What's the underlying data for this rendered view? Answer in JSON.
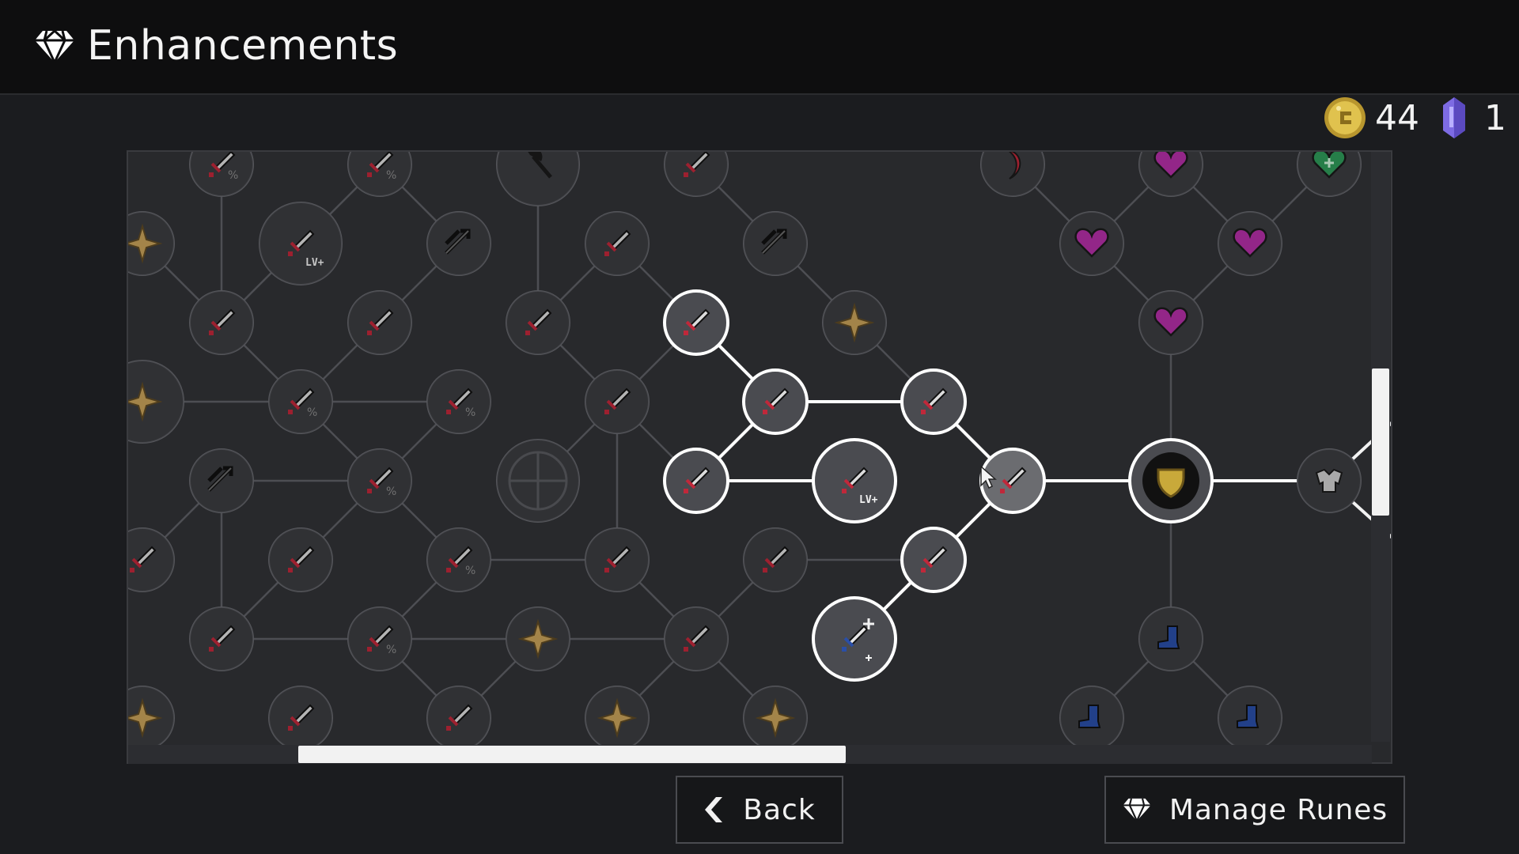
{
  "app": {
    "title": "Enhancements"
  },
  "currency": {
    "coins": {
      "icon": "gold-coin-icon",
      "value": "44"
    },
    "crystals": {
      "icon": "purple-crystal-icon",
      "value": "1"
    }
  },
  "buttons": {
    "back": {
      "label": "Back",
      "icon": "back-arrow-icon"
    },
    "manage_runes": {
      "label": "Manage Runes",
      "icon": "diamond-icon"
    }
  },
  "node_labels": {
    "level_up": "LV+"
  },
  "colors": {
    "background": "#1b1c1f",
    "panel": "#28292c",
    "node_locked": "#3b3c40",
    "node_unlocked": "#4a4b50",
    "highlight": "#ffffff",
    "heart": "#b42fa6",
    "shield_gold": "#c9a93a",
    "boot_blue": "#2a4fa8",
    "star_gold": "#c7a159"
  },
  "tree": {
    "nodes": [
      {
        "id": "n1",
        "kind": "sword-crit",
        "state": "locked"
      },
      {
        "id": "n2",
        "kind": "sword-crit",
        "state": "locked"
      },
      {
        "id": "n3",
        "kind": "axe",
        "state": "locked"
      },
      {
        "id": "n4",
        "kind": "sword",
        "state": "locked"
      },
      {
        "id": "n5",
        "kind": "moon",
        "state": "locked"
      },
      {
        "id": "n6",
        "kind": "heart",
        "state": "locked"
      },
      {
        "id": "n7",
        "kind": "green-heart",
        "state": "locked"
      },
      {
        "id": "n8",
        "kind": "star",
        "state": "locked"
      },
      {
        "id": "n9",
        "kind": "sword-level",
        "state": "locked"
      },
      {
        "id": "n10",
        "kind": "arrows",
        "state": "locked"
      },
      {
        "id": "n11",
        "kind": "sword",
        "state": "locked"
      },
      {
        "id": "n12",
        "kind": "arrows",
        "state": "locked"
      },
      {
        "id": "n13",
        "kind": "heart",
        "state": "locked"
      },
      {
        "id": "n14",
        "kind": "heart",
        "state": "locked"
      },
      {
        "id": "n15",
        "kind": "sword",
        "state": "locked"
      },
      {
        "id": "n16",
        "kind": "sword",
        "state": "locked"
      },
      {
        "id": "n17",
        "kind": "sword",
        "state": "locked"
      },
      {
        "id": "n18",
        "kind": "sword",
        "state": "unlocked"
      },
      {
        "id": "n19",
        "kind": "star",
        "state": "locked"
      },
      {
        "id": "n20",
        "kind": "heart",
        "state": "locked"
      },
      {
        "id": "n21",
        "kind": "star",
        "state": "locked"
      },
      {
        "id": "n22",
        "kind": "sword-crit",
        "state": "locked"
      },
      {
        "id": "n23",
        "kind": "sword-crit",
        "state": "locked"
      },
      {
        "id": "n24",
        "kind": "sword",
        "state": "locked"
      },
      {
        "id": "n25",
        "kind": "sword",
        "state": "unlocked"
      },
      {
        "id": "n26",
        "kind": "sword",
        "state": "unlocked"
      },
      {
        "id": "n27",
        "kind": "arrows",
        "state": "locked"
      },
      {
        "id": "n28",
        "kind": "sword-crit",
        "state": "locked"
      },
      {
        "id": "n29",
        "kind": "crosshair",
        "state": "locked"
      },
      {
        "id": "n30",
        "kind": "sword",
        "state": "unlocked"
      },
      {
        "id": "n31",
        "kind": "sword-level",
        "state": "unlocked"
      },
      {
        "id": "n32",
        "kind": "sword",
        "state": "selected"
      },
      {
        "id": "n33",
        "kind": "shield",
        "state": "unlocked"
      },
      {
        "id": "n34",
        "kind": "armor",
        "state": "locked"
      },
      {
        "id": "n35",
        "kind": "sword",
        "state": "locked"
      },
      {
        "id": "n36",
        "kind": "sword",
        "state": "locked"
      },
      {
        "id": "n37",
        "kind": "sword-crit",
        "state": "locked"
      },
      {
        "id": "n38",
        "kind": "sword",
        "state": "locked"
      },
      {
        "id": "n39",
        "kind": "sword",
        "state": "locked"
      },
      {
        "id": "n40",
        "kind": "sword",
        "state": "unlocked"
      },
      {
        "id": "n41",
        "kind": "sword",
        "state": "locked"
      },
      {
        "id": "n42",
        "kind": "sword-crit",
        "state": "locked"
      },
      {
        "id": "n43",
        "kind": "star",
        "state": "locked"
      },
      {
        "id": "n44",
        "kind": "sword",
        "state": "locked"
      },
      {
        "id": "n45",
        "kind": "blue-sword",
        "state": "unlocked"
      },
      {
        "id": "n46",
        "kind": "boot",
        "state": "locked"
      },
      {
        "id": "n47",
        "kind": "star",
        "state": "locked"
      },
      {
        "id": "n48",
        "kind": "sword",
        "state": "locked"
      },
      {
        "id": "n49",
        "kind": "sword",
        "state": "locked"
      },
      {
        "id": "n50",
        "kind": "star",
        "state": "locked"
      },
      {
        "id": "n51",
        "kind": "star",
        "state": "locked"
      },
      {
        "id": "n52",
        "kind": "boot",
        "state": "locked"
      },
      {
        "id": "n53",
        "kind": "boot",
        "state": "locked"
      }
    ]
  }
}
